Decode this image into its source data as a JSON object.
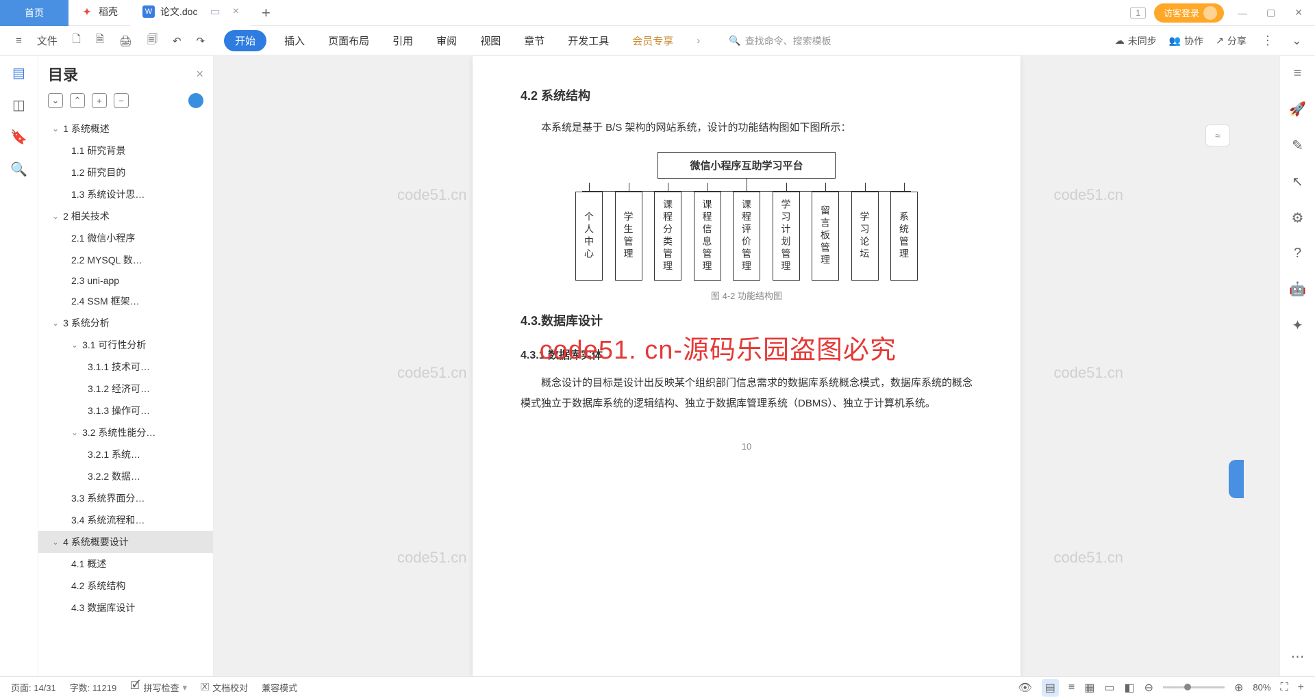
{
  "tabs": {
    "home": "首页",
    "shell": "稻壳",
    "doc": "论文.doc"
  },
  "guest_login": "访客登录",
  "window_box": "1",
  "file_menu": "文件",
  "menu": {
    "start": "开始",
    "insert": "插入",
    "page_layout": "页面布局",
    "reference": "引用",
    "review": "审阅",
    "view": "视图",
    "chapter": "章节",
    "dev_tools": "开发工具",
    "vip": "会员专享"
  },
  "search_placeholder": "查找命令、搜索模板",
  "toolbar_right": {
    "unsync": "未同步",
    "collab": "协作",
    "share": "分享"
  },
  "nav_title": "目录",
  "tree": [
    {
      "lvl": 1,
      "txt": "1 系统概述",
      "hc": true
    },
    {
      "lvl": 2,
      "txt": "1.1 研究背景"
    },
    {
      "lvl": 2,
      "txt": "1.2 研究目的"
    },
    {
      "lvl": 2,
      "txt": "1.3 系统设计思…"
    },
    {
      "lvl": 1,
      "txt": "2 相关技术",
      "hc": true
    },
    {
      "lvl": 2,
      "txt": "2.1 微信小程序"
    },
    {
      "lvl": 2,
      "txt": "2.2 MYSQL 数…"
    },
    {
      "lvl": 2,
      "txt": "2.3 uni-app"
    },
    {
      "lvl": 2,
      "txt": "2.4 SSM 框架…"
    },
    {
      "lvl": 1,
      "txt": "3 系统分析",
      "hc": true
    },
    {
      "lvl": 2,
      "txt": "3.1 可行性分析",
      "hc": true
    },
    {
      "lvl": 3,
      "txt": "3.1.1 技术可…"
    },
    {
      "lvl": 3,
      "txt": "3.1.2 经济可…"
    },
    {
      "lvl": 3,
      "txt": "3.1.3 操作可…"
    },
    {
      "lvl": 2,
      "txt": "3.2 系统性能分…",
      "hc": true
    },
    {
      "lvl": 3,
      "txt": "3.2.1 系统…"
    },
    {
      "lvl": 3,
      "txt": "3.2.2 数据…"
    },
    {
      "lvl": 2,
      "txt": "3.3 系统界面分…"
    },
    {
      "lvl": 2,
      "txt": "3.4 系统流程和…"
    },
    {
      "lvl": 1,
      "txt": "4 系统概要设计",
      "hc": true,
      "sel": true
    },
    {
      "lvl": 2,
      "txt": "4.1 概述"
    },
    {
      "lvl": 2,
      "txt": "4.2 系统结构"
    },
    {
      "lvl": 2,
      "txt": "4.3 数据库设计"
    }
  ],
  "doc": {
    "h42": "4.2 系统结构",
    "intro": "本系统是基于 B/S 架构的网站系统，设计的功能结构图如下图所示：",
    "diagram_root": "微信小程序互助学习平台",
    "diagram_children": [
      "个人中心",
      "学生管理",
      "课程分类管理",
      "课程信息管理",
      "课程评价管理",
      "学习计划管理",
      "留言板管理",
      "学习论坛",
      "系统管理"
    ],
    "diagram_caption": "图 4-2 功能结构图",
    "h43": "4.3.数据库设计",
    "h431": "4.3.1 数据库实体",
    "p431": "概念设计的目标是设计出反映某个组织部门信息需求的数据库系统概念模式，数据库系统的概念模式独立于数据库系统的逻辑结构、独立于数据库管理系统（DBMS）、独立于计算机系统。",
    "page_num": "10"
  },
  "big_watermark": "code51. cn-源码乐园盗图必究",
  "small_watermark": "code51.cn",
  "status": {
    "page": "页面: 14/31",
    "words": "字数: 11219",
    "spell": "拼写检查",
    "proof": "文档校对",
    "compat": "兼容模式",
    "zoom": "80%"
  }
}
